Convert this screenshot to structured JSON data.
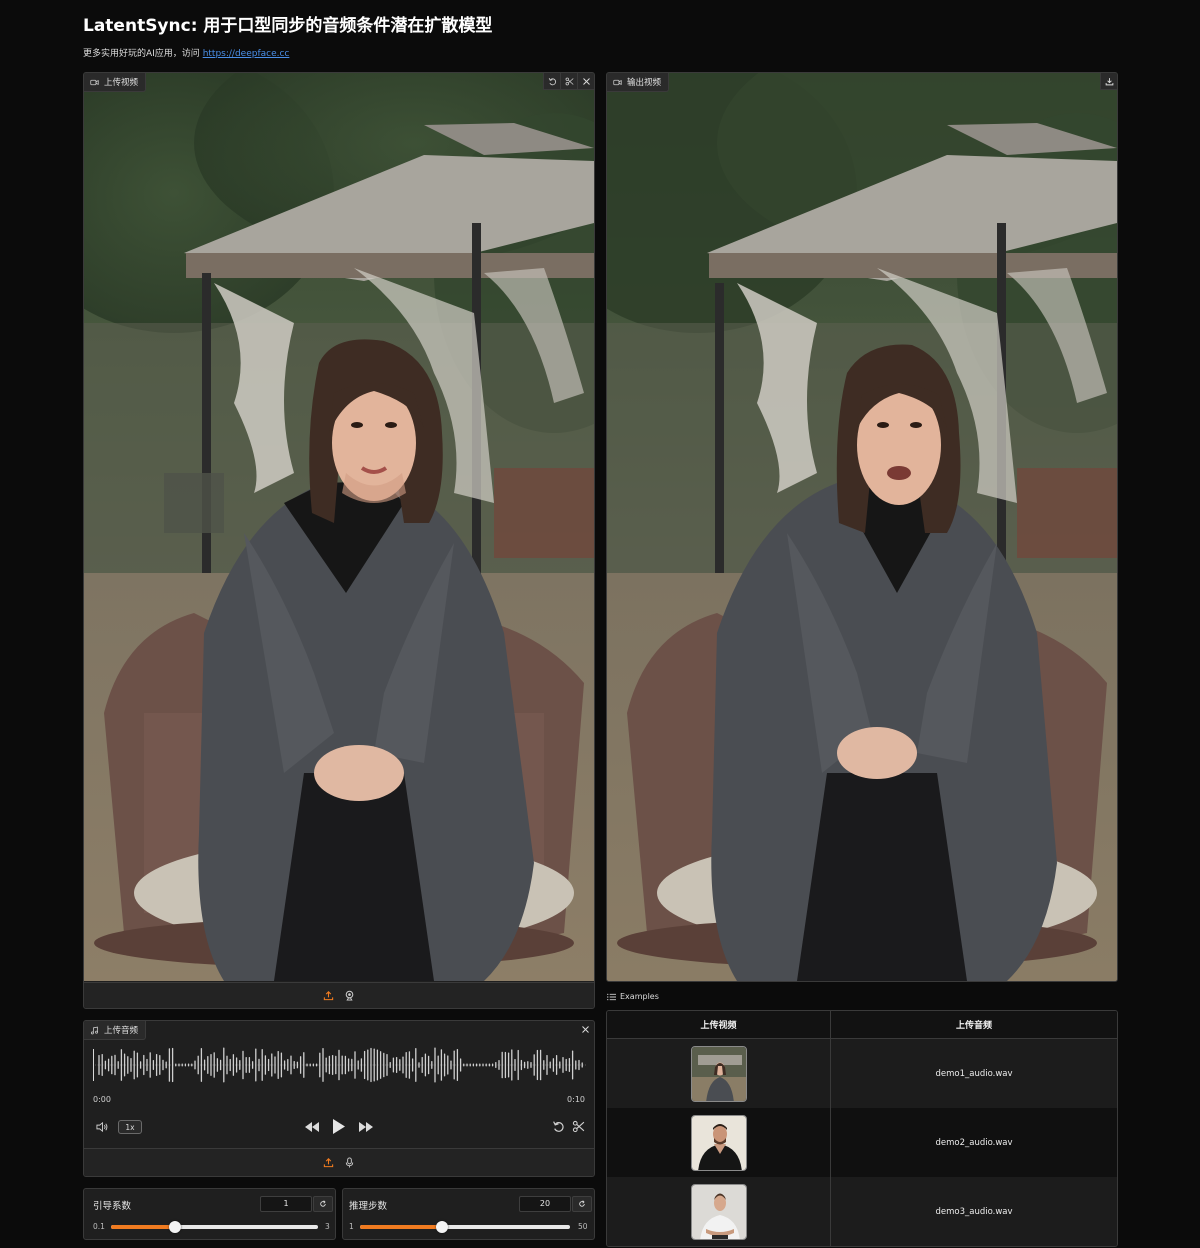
{
  "page": {
    "title": "LatentSync: 用于口型同步的音频条件潜在扩散模型",
    "subtitle_text": "更多实用好玩的AI应用，访问 ",
    "subtitle_link": "https://deepface.cc"
  },
  "input_video": {
    "label": "上传视频",
    "icons": [
      "video-icon",
      "undo-icon",
      "scissors-icon",
      "close-icon",
      "upload-icon",
      "webcam-icon"
    ]
  },
  "output_video": {
    "label": "输出视频",
    "icons": [
      "video-icon",
      "download-icon"
    ]
  },
  "audio": {
    "label": "上传音频",
    "time_start": "0:00",
    "time_end": "0:10",
    "speed": "1x",
    "icons": [
      "music-icon",
      "close-icon",
      "volume-icon",
      "rewind-icon",
      "play-icon",
      "forward-icon",
      "undo-icon",
      "scissors-icon",
      "upload-icon",
      "microphone-icon"
    ]
  },
  "guidance": {
    "label": "引导系数",
    "value": "1",
    "min": "0.1",
    "max": "3",
    "fraction": 0.31
  },
  "steps": {
    "label": "推理步数",
    "value": "20",
    "min": "1",
    "max": "50",
    "fraction": 0.39
  },
  "examples": {
    "heading": "Examples",
    "columns": [
      "上传视频",
      "上传音频"
    ],
    "rows": [
      {
        "audio": "demo1_audio.wav"
      },
      {
        "audio": "demo2_audio.wav"
      },
      {
        "audio": "demo3_audio.wav"
      }
    ]
  },
  "colors": {
    "accent": "#f07b20",
    "background": "#0b0b0b",
    "panel": "#1f1f1f",
    "link": "#4a8fe8"
  }
}
